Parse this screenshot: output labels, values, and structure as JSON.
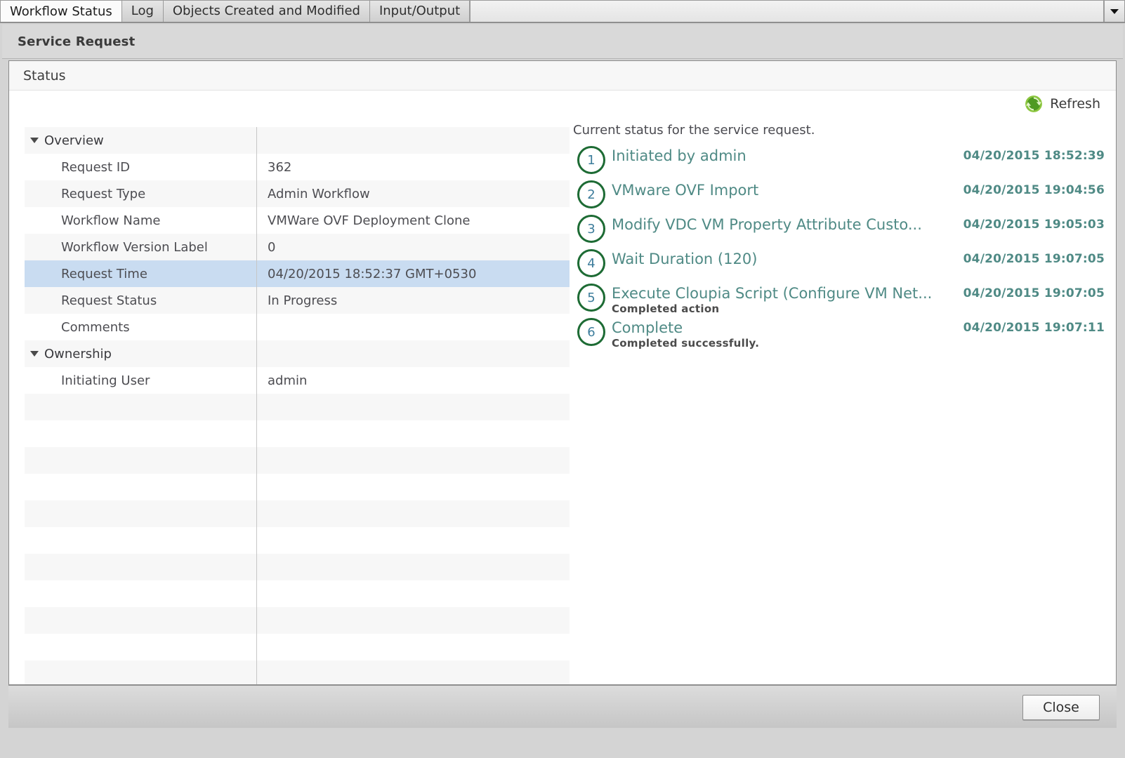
{
  "tabs": [
    {
      "label": "Workflow Status",
      "active": true
    },
    {
      "label": "Log",
      "active": false
    },
    {
      "label": "Objects Created and Modified",
      "active": false
    },
    {
      "label": "Input/Output",
      "active": false
    }
  ],
  "tab_overflow_icon": "chevron-down-icon",
  "panel": {
    "title": "Service Request",
    "section_header": "Status"
  },
  "toolbar": {
    "refresh_label": "Refresh",
    "refresh_icon": "refresh-icon"
  },
  "properties": [
    {
      "type": "group",
      "key": "Overview",
      "value": "",
      "selected": false
    },
    {
      "type": "item",
      "key": "Request ID",
      "value": "362",
      "selected": false
    },
    {
      "type": "item",
      "key": "Request Type",
      "value": "Admin Workflow",
      "selected": false
    },
    {
      "type": "item",
      "key": "Workflow Name",
      "value": "VMWare OVF Deployment Clone",
      "selected": false
    },
    {
      "type": "item",
      "key": "Workflow Version Label",
      "value": "0",
      "selected": false
    },
    {
      "type": "item",
      "key": "Request Time",
      "value": "04/20/2015 18:52:37 GMT+0530",
      "selected": true
    },
    {
      "type": "item",
      "key": "Request Status",
      "value": "In Progress",
      "selected": false
    },
    {
      "type": "item",
      "key": "Comments",
      "value": "",
      "selected": false
    },
    {
      "type": "group",
      "key": "Ownership",
      "value": "",
      "selected": false
    },
    {
      "type": "item",
      "key": "Initiating User",
      "value": "admin",
      "selected": false
    }
  ],
  "status_panel": {
    "caption": "Current status for the service request.",
    "steps": [
      {
        "number": "1",
        "title": "Initiated by admin",
        "subtitle": "",
        "time": "04/20/2015 18:52:39"
      },
      {
        "number": "2",
        "title": "VMware OVF Import",
        "subtitle": "",
        "time": "04/20/2015 19:04:56"
      },
      {
        "number": "3",
        "title": "Modify VDC VM Property Attribute Custo...",
        "subtitle": "",
        "time": "04/20/2015 19:05:03"
      },
      {
        "number": "4",
        "title": "Wait Duration (120)",
        "subtitle": "",
        "time": "04/20/2015 19:07:05"
      },
      {
        "number": "5",
        "title": "Execute Cloupia Script (Configure VM Net...",
        "subtitle": "Completed action",
        "time": "04/20/2015 19:07:05"
      },
      {
        "number": "6",
        "title": "Complete",
        "subtitle": "Completed successfully.",
        "time": "04/20/2015 19:07:11"
      }
    ]
  },
  "footer": {
    "close_label": "Close"
  },
  "colors": {
    "step_circle_border": "#1d6b34",
    "step_text": "#4f8a85",
    "selected_row": "#c9dcf1",
    "alt_row": "#f7f7f7",
    "refresh_icon_green": "#5aa832"
  }
}
